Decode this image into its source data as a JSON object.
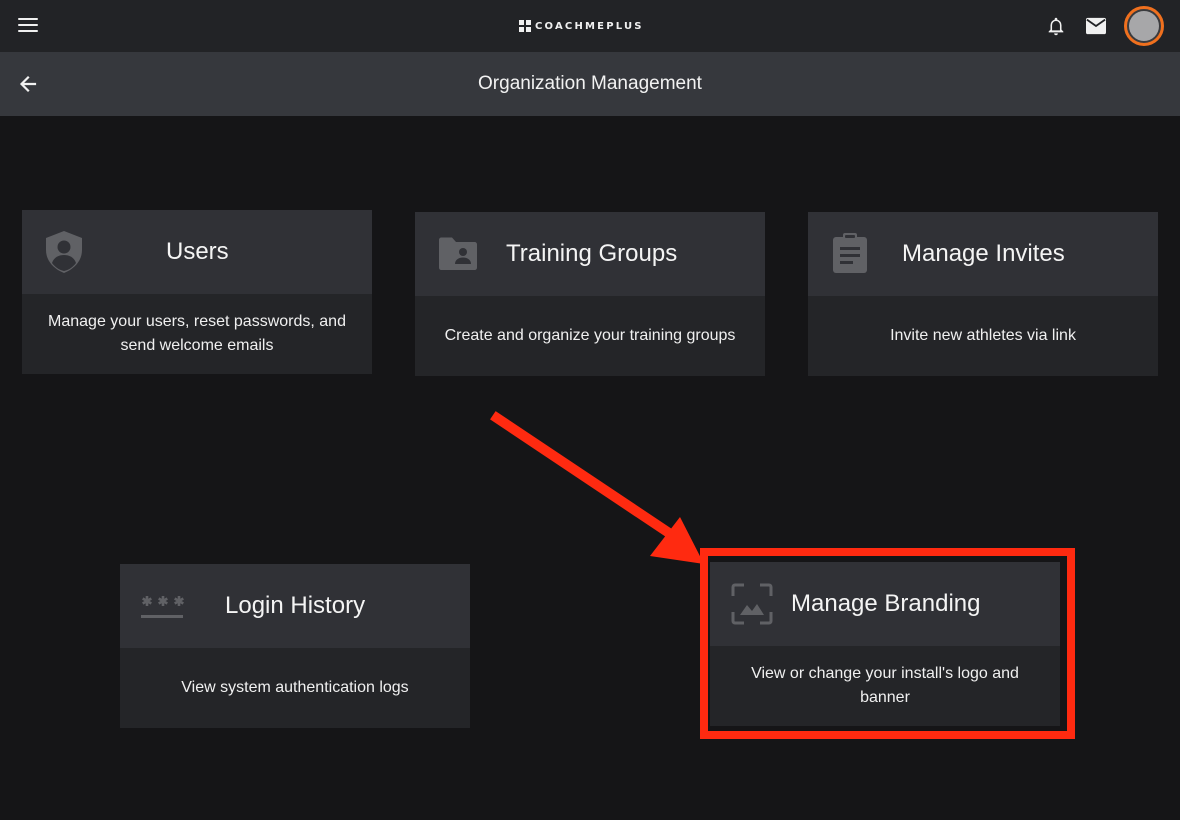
{
  "app": {
    "brand_name": "COACHMEPLUS",
    "accent_color": "#f0701e",
    "highlight_color": "#ff2a10"
  },
  "header": {
    "title": "Organization Management",
    "icons": [
      "menu-icon",
      "bell-icon",
      "mail-icon",
      "avatar",
      "back-arrow-icon"
    ]
  },
  "cards": {
    "users": {
      "title": "Users",
      "description": "Manage your users, reset passwords, and send welcome emails",
      "icon": "shield-user-icon"
    },
    "training_groups": {
      "title": "Training Groups",
      "description": "Create and organize your training groups",
      "icon": "folder-user-icon"
    },
    "manage_invites": {
      "title": "Manage Invites",
      "description": "Invite new athletes via link",
      "icon": "clipboard-icon"
    },
    "login_history": {
      "title": "Login History",
      "description": "View system authentication logs",
      "icon": "password-icon"
    },
    "manage_branding": {
      "title": "Manage Branding",
      "description": "View or change your install's logo and banner",
      "icon": "image-frame-icon"
    }
  }
}
